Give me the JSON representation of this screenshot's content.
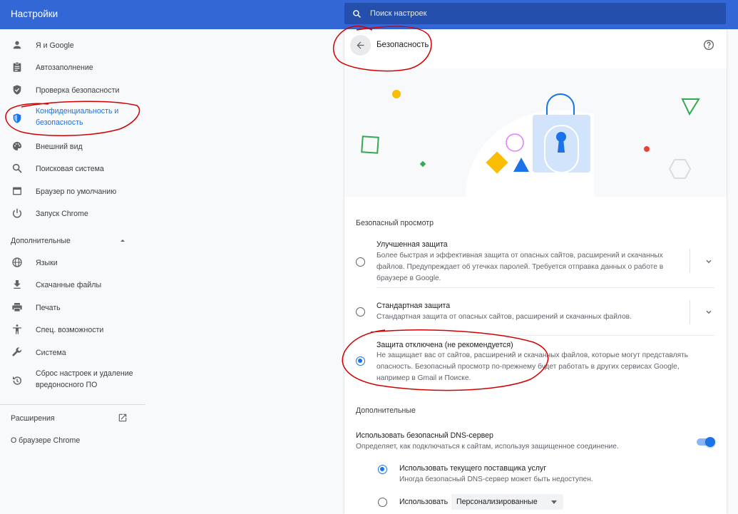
{
  "app": {
    "title": "Настройки"
  },
  "search": {
    "placeholder": "Поиск настроек"
  },
  "sidebar": {
    "items": [
      {
        "label": "Я и Google",
        "icon": "person-icon"
      },
      {
        "label": "Автозаполнение",
        "icon": "assignment-icon"
      },
      {
        "label": "Проверка безопасности",
        "icon": "shield-check-icon"
      },
      {
        "label": "Конфиденциальность и безопасность",
        "icon": "privacy-shield-icon",
        "active": true
      },
      {
        "label": "Внешний вид",
        "icon": "palette-icon"
      },
      {
        "label": "Поисковая система",
        "icon": "search-icon"
      },
      {
        "label": "Браузер по умолчанию",
        "icon": "browser-window-icon"
      },
      {
        "label": "Запуск Chrome",
        "icon": "power-icon"
      }
    ],
    "advanced_label": "Дополнительные",
    "advanced_items": [
      {
        "label": "Языки",
        "icon": "globe-icon"
      },
      {
        "label": "Скачанные файлы",
        "icon": "download-icon"
      },
      {
        "label": "Печать",
        "icon": "printer-icon"
      },
      {
        "label": "Спец. возможности",
        "icon": "accessibility-icon"
      },
      {
        "label": "Система",
        "icon": "wrench-icon"
      },
      {
        "label": "Сброс настроек и удаление вредоносного ПО",
        "icon": "restore-icon"
      }
    ],
    "extensions_label": "Расширения",
    "about_label": "О браузере Chrome"
  },
  "panel": {
    "title": "Безопасность",
    "safe_browsing_heading": "Безопасный просмотр",
    "options": [
      {
        "title": "Улучшенная защита",
        "description": "Более быстрая и эффективная защита от опасных сайтов, расширений и скачанных файлов. Предупреждает об утечках паролей. Требуется отправка данных о работе в браузере в Google.",
        "selected": false,
        "expandable": true
      },
      {
        "title": "Стандартная защита",
        "description": "Стандартная защита от опасных сайтов, расширений и скачанных файлов.",
        "selected": false,
        "expandable": true
      },
      {
        "title": "Защита отключена (не рекомендуется)",
        "description": "Не защищает вас от сайтов, расширений и скачанных файлов, которые могут представлять опасность. Безопасный просмотр по-прежнему будет работать в других сервисах Google, например в Gmail и Поиске.",
        "selected": true,
        "expandable": false
      }
    ],
    "advanced_heading": "Дополнительные",
    "dns": {
      "title": "Использовать безопасный DNS-сервер",
      "description": "Определяет, как подключаться к сайтам, используя защищенное соединение.",
      "enabled": true,
      "current_provider_label": "Использовать текущего поставщика услуг",
      "current_provider_note": "Иногда безопасный DNS-сервер может быть недоступен.",
      "custom_label": "Использовать",
      "custom_select_value": "Персонализированные"
    }
  },
  "colors": {
    "header": "#3367d6",
    "accent": "#1a73e8",
    "annotation": "#d50000"
  }
}
